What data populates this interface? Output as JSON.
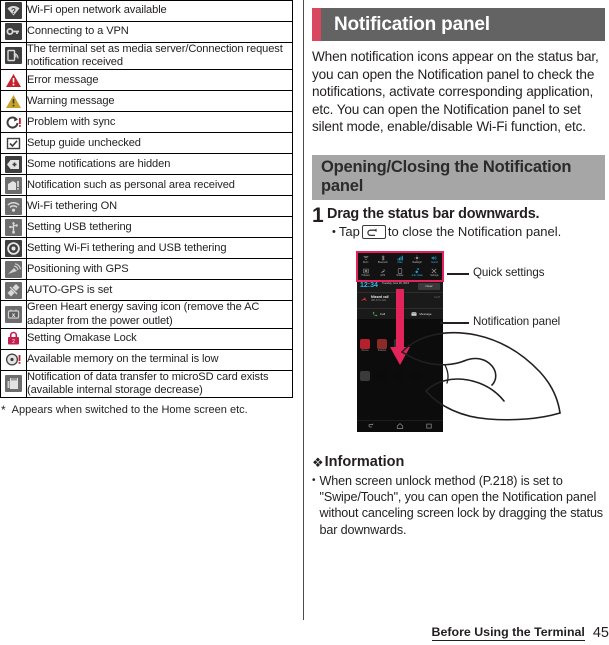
{
  "status_icon_table": {
    "rows": [
      {
        "icon": "wifi-open-network-icon",
        "desc": "Wi-Fi open network available"
      },
      {
        "icon": "vpn-key-icon",
        "desc": "Connecting to a VPN"
      },
      {
        "icon": "media-server-icon",
        "desc": "The terminal set as media server/Connection request notification received"
      },
      {
        "icon": "error-triangle-icon",
        "desc": "Error message"
      },
      {
        "icon": "warning-triangle-icon",
        "desc": "Warning message"
      },
      {
        "icon": "sync-problem-icon",
        "desc": "Problem with sync"
      },
      {
        "icon": "setup-guide-check-icon",
        "desc": "Setup guide unchecked"
      },
      {
        "icon": "hidden-notifications-icon",
        "desc": "Some notifications are hidden"
      },
      {
        "icon": "personal-area-icon",
        "desc": "Notification such as personal area received"
      },
      {
        "icon": "wifi-tethering-icon",
        "desc": "Wi-Fi tethering ON"
      },
      {
        "icon": "usb-tethering-icon",
        "desc": "Setting USB tethering"
      },
      {
        "icon": "wifi-usb-tethering-icon",
        "desc": "Setting Wi-Fi tethering and USB tethering"
      },
      {
        "icon": "gps-positioning-icon",
        "desc": "Positioning with GPS"
      },
      {
        "icon": "auto-gps-icon",
        "desc": "AUTO-GPS is set"
      },
      {
        "icon": "green-heart-eco-icon",
        "desc": "Green Heart energy saving icon (remove the AC adapter from the power outlet)"
      },
      {
        "icon": "omakase-lock-icon",
        "desc": "Setting Omakase Lock"
      },
      {
        "icon": "low-memory-icon",
        "desc": "Available memory on the terminal is low"
      },
      {
        "icon": "microsd-transfer-icon",
        "desc": "Notification of data transfer to microSD card exists (available internal storage decrease)"
      }
    ],
    "footnote_marker": "*",
    "footnote": "Appears when switched to the Home screen etc."
  },
  "right": {
    "main_heading": "Notification panel",
    "intro_paragraph": "When notification icons appear on the status bar, you can open the Notification panel to check the notifications, activate corresponding application, etc. You can open the Notification panel to set silent mode, enable/disable Wi-Fi function, etc.",
    "sub_heading": "Opening/Closing the Notification panel",
    "step": {
      "number": "1",
      "title": "Drag the status bar downwards.",
      "bullet_dot": "•",
      "bullet_before": "Tap",
      "bullet_icon": "back-key-icon",
      "bullet_after": "to close the Notification panel."
    },
    "illustration": {
      "callouts": [
        {
          "label": "Quick settings",
          "name": "callout-quick-settings"
        },
        {
          "label": "Notification panel",
          "name": "callout-notification-panel"
        }
      ],
      "phone": {
        "quick_settings": [
          {
            "label": "Wi-Fi",
            "icon": "wifi-icon",
            "active": false
          },
          {
            "label": "Bluetooth",
            "icon": "bluetooth-icon",
            "active": false
          },
          {
            "label": "Data",
            "icon": "mobile-data-icon",
            "active": true
          },
          {
            "label": "Backlight",
            "icon": "brightness-icon",
            "active": false
          },
          {
            "label": "Sound",
            "icon": "volume-icon",
            "active": true
          },
          {
            "label": "Hotspot",
            "icon": "hotspot-icon",
            "active": false
          },
          {
            "label": "GPS",
            "icon": "gps-icon",
            "active": false
          },
          {
            "label": "Rotate",
            "icon": "rotate-icon",
            "active": false
          },
          {
            "label": "Auto rotate",
            "icon": "autorotate-icon",
            "active": true
          },
          {
            "label": "Settings",
            "icon": "settings-icon",
            "active": false
          }
        ],
        "clock": "12:34",
        "date": "Tuesday June 30, 2015",
        "clear_button": "Clear",
        "notification": {
          "icon": "missed-call-icon",
          "title": "Missed call",
          "subtitle": "080-XXX-1111",
          "time": "11:47"
        },
        "notification_actions": [
          {
            "label": "Call",
            "icon": "call-icon"
          },
          {
            "label": "Message",
            "icon": "message-icon"
          }
        ],
        "home_apps_row1": [
          {
            "label": "dmenu",
            "icon": "dmenu-icon",
            "color": "#b5202c"
          },
          {
            "label": "dmarket",
            "icon": "dmarket-icon",
            "color": "#8c2a2a"
          },
          {
            "label": "Play Store",
            "icon": "play-store-icon",
            "color": "#2f2f2f"
          }
        ],
        "home_apps_row2": [
          {
            "label": "",
            "icon": "app-drawer-icon",
            "color": "#3a3a3a"
          },
          {
            "label": "",
            "icon": "phone-icon",
            "color": "#0b0b0b"
          },
          {
            "label": "",
            "icon": "mail-icon",
            "color": "#0b0b0b"
          },
          {
            "label": "",
            "icon": "browser-icon",
            "color": "#0b0b0b"
          }
        ],
        "navbar": [
          {
            "icon": "nav-back-icon"
          },
          {
            "icon": "nav-home-icon"
          },
          {
            "icon": "nav-recents-icon"
          }
        ]
      }
    },
    "information": {
      "diamond": "❖",
      "heading": "Information",
      "items": [
        {
          "dot": "•",
          "text": "When screen unlock method (P.218) is set to \"Swipe/Touch\", you can open the Notification panel without canceling screen lock by dragging the status bar downwards."
        }
      ]
    }
  },
  "footer": {
    "chapter": "Before Using the Terminal",
    "page": "45"
  },
  "colors": {
    "accent_red": "#d9485f",
    "band_dark": "#636363",
    "band_light": "#a6a6a6",
    "arrow_red": "#e2245a",
    "text": "#231f20"
  }
}
